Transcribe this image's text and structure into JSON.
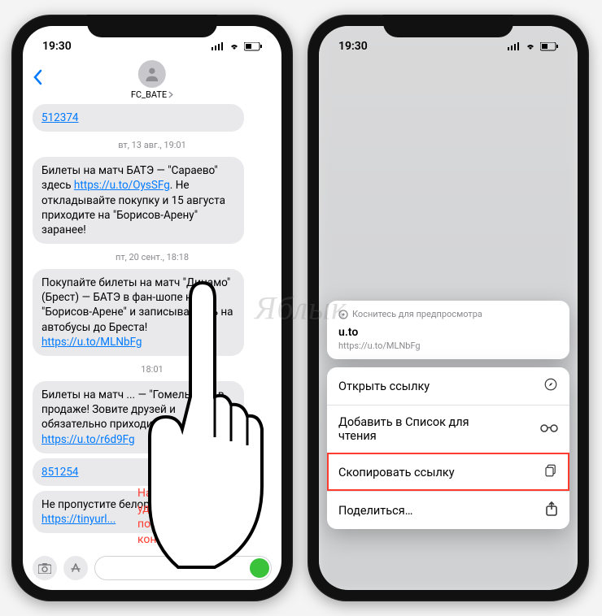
{
  "watermark": "Яблык",
  "callout_text": "Нажмите и удерживайте до появления контекстного меню",
  "left_phone": {
    "status": {
      "time": "19:30"
    },
    "contact_name": "FC_BATE",
    "messages": [
      {
        "type": "bubble",
        "text": "512374",
        "is_link": true
      },
      {
        "type": "date",
        "text": "вт, 13 авг., 19:01"
      },
      {
        "type": "bubble",
        "text_parts": [
          "Билеты на матч БАТЭ — \"Сараево\" здесь ",
          {
            "link": "https://u.to/OysSFg"
          },
          ". Не откладывайте покупку и 15 августа приходите на \"Борисов-Арену\" заранее!"
        ]
      },
      {
        "type": "date",
        "text": "пт, 20 сент., 18:18"
      },
      {
        "type": "bubble",
        "text_parts": [
          "Покупайте билеты на матч \"Динамо\" (Брест) — БАТЭ в фан-шопе на \"Борисов-Арене\" и записывайтесь на автобусы до Бреста! ",
          {
            "link": "https://u.to/MLNbFg"
          }
        ]
      },
      {
        "type": "date",
        "text": "18:01"
      },
      {
        "type": "bubble",
        "text_parts": [
          "Билеты на матч ... — \"Гомель\" уже в продаже! Зовите друзей и обязательно приходите! ",
          {
            "link": "https://u.to/r6d9Fg"
          }
        ]
      },
      {
        "type": "bubble",
        "text": "851254",
        "is_link": true
      },
      {
        "type": "bubble",
        "text_parts": [
          "Не пропустите белорусское \"... ",
          {
            "link": "https://tinyurl..."
          }
        ]
      }
    ]
  },
  "right_phone": {
    "status": {
      "time": "19:30"
    },
    "preview": {
      "hint": "Коснитесь для предпросмотра",
      "title": "u.to",
      "url": "https://u.to/MLNbFg"
    },
    "menu": [
      {
        "label": "Открыть ссылку",
        "icon": "compass",
        "highlight": false
      },
      {
        "label": "Добавить в Список для чтения",
        "icon": "glasses",
        "highlight": false
      },
      {
        "label": "Скопировать ссылку",
        "icon": "copy",
        "highlight": true
      },
      {
        "label": "Поделиться…",
        "icon": "share",
        "highlight": false
      }
    ]
  }
}
